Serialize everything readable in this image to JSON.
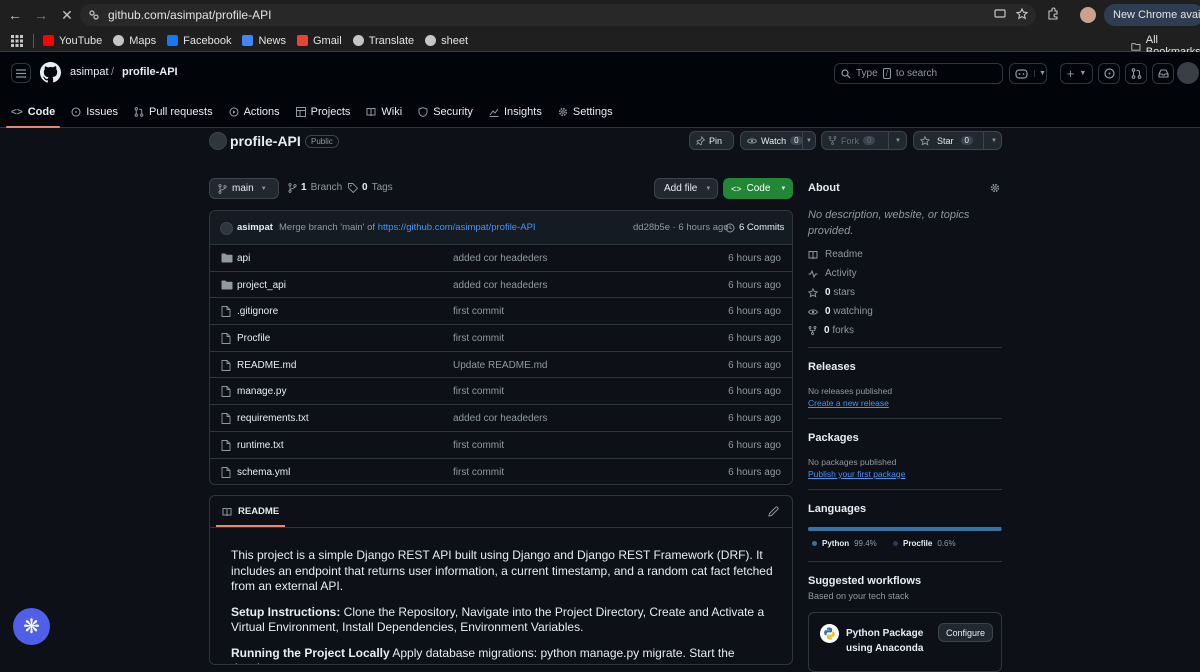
{
  "browser": {
    "url": "github.com/asimpat/profile-API",
    "new_chrome": "New Chrome available",
    "bookmarks": [
      {
        "label": "YouTube",
        "color": "#ff0000"
      },
      {
        "label": "Maps",
        "color": "#c4c7c5"
      },
      {
        "label": "Facebook",
        "color": "#1877f2"
      },
      {
        "label": "News",
        "color": "#4285f4"
      },
      {
        "label": "Gmail",
        "color": "#ea4335"
      },
      {
        "label": "Translate",
        "color": "#c4c7c5"
      },
      {
        "label": "sheet",
        "color": "#c4c7c5"
      }
    ],
    "all_bookmarks": "All Bookmarks"
  },
  "header": {
    "owner": "asimpat",
    "slash": "/",
    "repo": "profile-API",
    "search_prefix": "Type",
    "search_key": "/",
    "search_suffix": "to search",
    "tabs": [
      {
        "label": "Code",
        "icon": "code-icon",
        "active": true
      },
      {
        "label": "Issues",
        "icon": "issue-icon"
      },
      {
        "label": "Pull requests",
        "icon": "pull-request-icon"
      },
      {
        "label": "Actions",
        "icon": "play-icon"
      },
      {
        "label": "Projects",
        "icon": "table-icon"
      },
      {
        "label": "Wiki",
        "icon": "book-icon"
      },
      {
        "label": "Security",
        "icon": "shield-icon"
      },
      {
        "label": "Insights",
        "icon": "graph-icon"
      },
      {
        "label": "Settings",
        "icon": "gear-icon"
      }
    ]
  },
  "repo": {
    "name": "profile-API",
    "visibility": "Public",
    "pin": "Pin",
    "watch": "Watch",
    "watch_count": "0",
    "fork": "Fork",
    "fork_count": "0",
    "star": "Star",
    "star_count": "0",
    "branch": "main",
    "branch_count": "1",
    "branch_label": "Branch",
    "tag_count": "0",
    "tag_label": "Tags",
    "add_file": "Add file",
    "code": "Code"
  },
  "commit": {
    "author": "asimpat",
    "message_prefix": "Merge branch 'main' of",
    "message_link": "https://github.com/asimpat/profile-API",
    "hash_time": "dd28b5e · 6 hours ago",
    "commits": "6 Commits"
  },
  "files": [
    {
      "name": "api",
      "type": "folder",
      "message": "added cor headeders",
      "age": "6 hours ago"
    },
    {
      "name": "project_api",
      "type": "folder",
      "message": "added cor headeders",
      "age": "6 hours ago"
    },
    {
      "name": ".gitignore",
      "type": "file",
      "message": "first commit",
      "age": "6 hours ago"
    },
    {
      "name": "Procfile",
      "type": "file",
      "message": "first commit",
      "age": "6 hours ago"
    },
    {
      "name": "README.md",
      "type": "file",
      "message": "Update README.md",
      "age": "6 hours ago"
    },
    {
      "name": "manage.py",
      "type": "file",
      "message": "first commit",
      "age": "6 hours ago"
    },
    {
      "name": "requirements.txt",
      "type": "file",
      "message": "added cor headeders",
      "age": "6 hours ago"
    },
    {
      "name": "runtime.txt",
      "type": "file",
      "message": "first commit",
      "age": "6 hours ago"
    },
    {
      "name": "schema.yml",
      "type": "file",
      "message": "first commit",
      "age": "6 hours ago"
    }
  ],
  "readme": {
    "tab": "README",
    "p1": "This project is a simple Django REST API built using Django and Django REST Framework (DRF). It includes an endpoint that returns user information, a current timestamp, and a random cat fact fetched from an external API.",
    "p2_bold": "Setup Instructions:",
    "p2": " Clone the Repository, Navigate into the Project Directory, Create and Activate a Virtual Environment, Install Dependencies, Environment Variables.",
    "p3_bold": "Running the Project Locally",
    "p3": " Apply database migrations: python manage.py migrate. Start the development"
  },
  "sidebar": {
    "about": "About",
    "description": "No description, website, or topics provided.",
    "readme": "Readme",
    "activity": "Activity",
    "stars_count": "0",
    "stars": "stars",
    "watching_count": "0",
    "watching": "watching",
    "forks_count": "0",
    "forks": "forks",
    "releases": "Releases",
    "no_releases": "No releases published",
    "create_release": "Create a new release",
    "packages": "Packages",
    "no_packages": "No packages published",
    "publish_package": "Publish your first package",
    "languages": "Languages",
    "langs": [
      {
        "name": "Python",
        "percent": "99.4%",
        "value": 99.4,
        "color": "#3572a5"
      },
      {
        "name": "Procfile",
        "percent": "0.6%",
        "value": 0.6,
        "color": "#3b2f63"
      }
    ],
    "workflows": "Suggested workflows",
    "workflows_sub": "Based on your tech stack",
    "workflow_name": "Python Package using Anaconda",
    "configure": "Configure"
  }
}
